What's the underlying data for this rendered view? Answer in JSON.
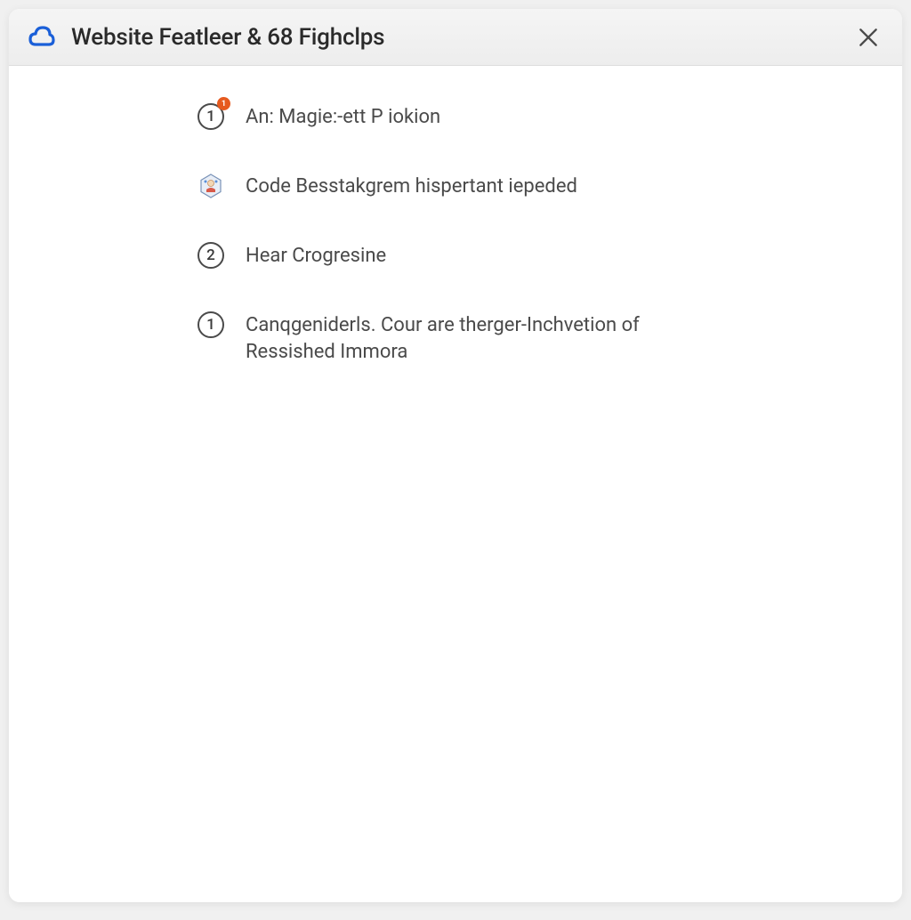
{
  "header": {
    "title": "Website Featleer & 68 Fighclps"
  },
  "items": [
    {
      "icon_type": "circle-number",
      "number": "1",
      "badge": "1",
      "label": "An: Magie:-ett P iokion"
    },
    {
      "icon_type": "hex-badge",
      "label": "Code Besstakgrem hispertant iepeded"
    },
    {
      "icon_type": "circle-number",
      "number": "2",
      "label": "Hear Crogresine"
    },
    {
      "icon_type": "circle-number",
      "number": "1",
      "label": "Canqgeniderls. Cour are therger-Inchvetion of Ressished Immora"
    }
  ]
}
